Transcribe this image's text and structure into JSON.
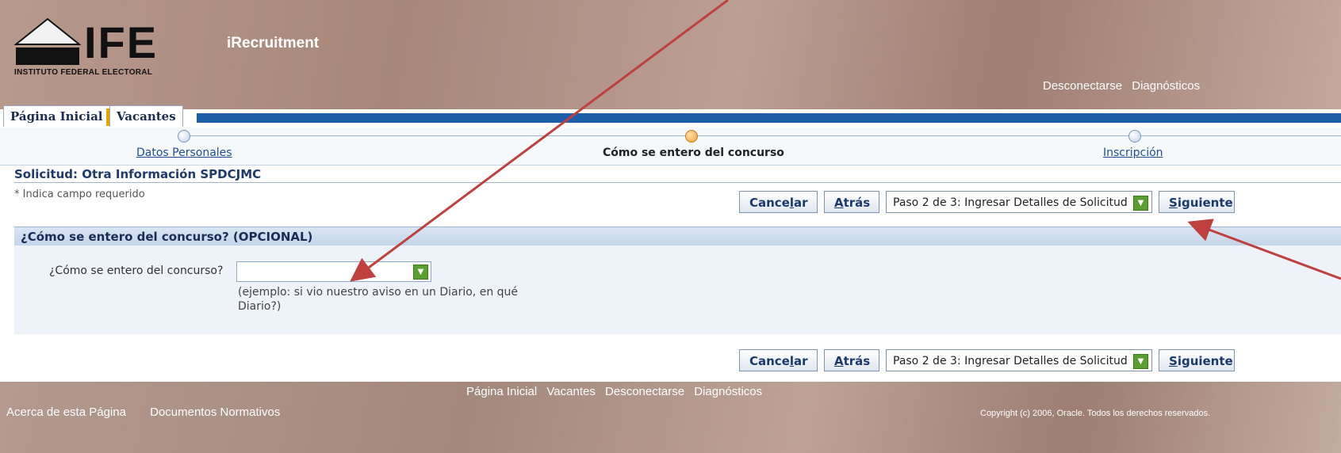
{
  "header": {
    "logo_text": "IFE",
    "logo_subtitle": "INSTITUTO FEDERAL ELECTORAL",
    "app_name": "iRecruitment",
    "global_links": [
      "Desconectarse",
      "Diagnósticos"
    ]
  },
  "tabs": [
    {
      "label": "Página Inicial"
    },
    {
      "label": "Vacantes"
    }
  ],
  "train": {
    "steps": [
      {
        "label": "Datos Personales",
        "state": "visited"
      },
      {
        "label": "Cómo se entero del concurso",
        "state": "current"
      },
      {
        "label": "Inscripción",
        "state": "next"
      }
    ]
  },
  "page": {
    "title": "Solicitud: Otra Información SPDCJMC",
    "required_note": "Indica campo requerido",
    "required_marker": "*"
  },
  "actions": {
    "cancel_pre": "Cance",
    "cancel_key": "l",
    "cancel_post": "ar",
    "back_key": "A",
    "back_post": "trás",
    "step_select": "Paso 2 de 3: Ingresar Detalles de Solicitud",
    "next_key": "S",
    "next_post": "iguiente"
  },
  "section": {
    "header": "¿Cómo se entero del concurso? (OPCIONAL)",
    "field_label": "¿Cómo se entero del concurso?",
    "field_value": "",
    "hint": "(ejemplo: si vio nuestro aviso en un Diario, en qué Diario?)"
  },
  "footer": {
    "links": [
      "Página Inicial",
      "Vacantes",
      "Desconectarse",
      "Diagnósticos"
    ],
    "left_links": [
      "Acerca de esta Página",
      "Documentos Normativos"
    ],
    "copyright": "Copyright (c) 2006, Oracle. Todos los derechos reservados."
  },
  "colors": {
    "header_bg": "#a6877a",
    "tab_bar": "#1c5ea8",
    "annotation_arrow": "#c0403f",
    "select_arrow": "#5aa030"
  }
}
